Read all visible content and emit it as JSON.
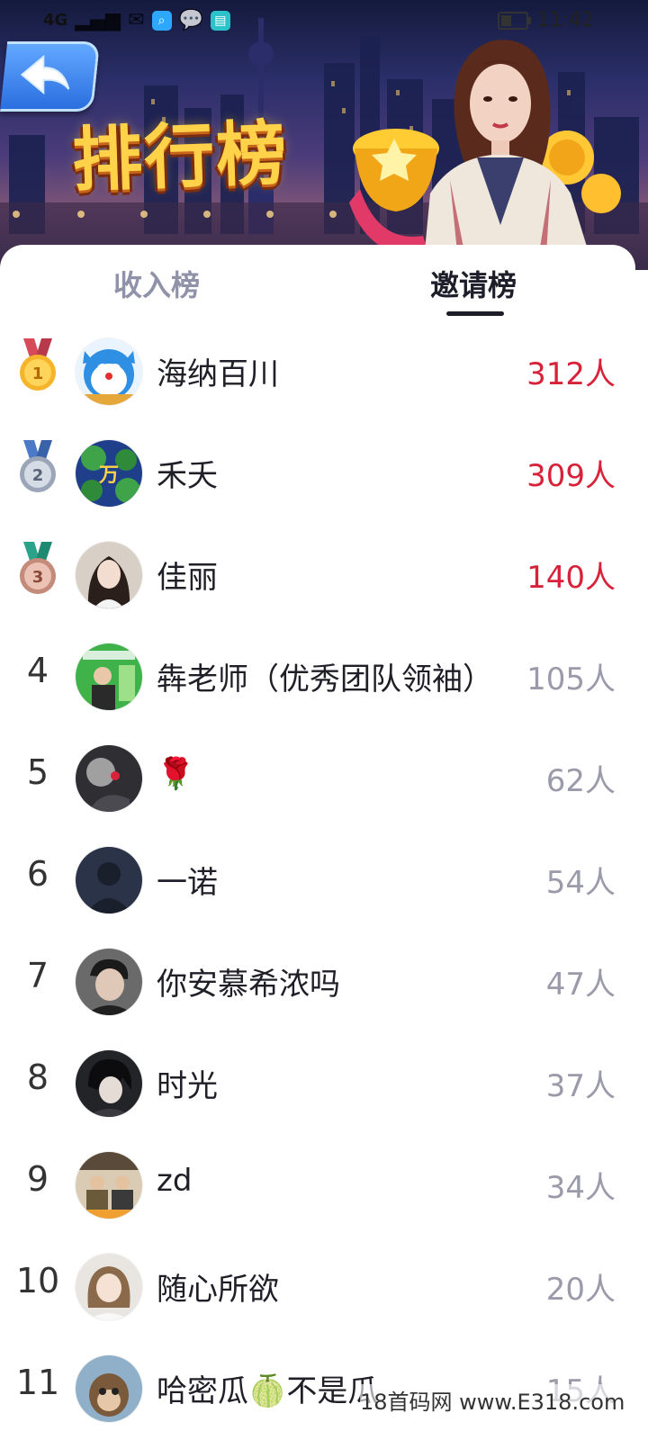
{
  "status_bar": {
    "signal_text": "4G",
    "time": "11:42",
    "battery_level": 0.45
  },
  "header": {
    "title": "排行榜"
  },
  "tabs": [
    {
      "label": "收入榜",
      "active": false
    },
    {
      "label": "邀请榜",
      "active": true
    }
  ],
  "colors": {
    "accent_red": "#d8223a",
    "count_gray": "#9a9aaa",
    "active_tab": "#1e1e2a",
    "inactive_tab": "#8f92a8"
  },
  "rows": [
    {
      "rank": "1",
      "medal": "gold-medal-icon",
      "name": "海纳百川",
      "count": "312人"
    },
    {
      "rank": "2",
      "medal": "silver-medal-icon",
      "name": "禾夭",
      "count": "309人"
    },
    {
      "rank": "3",
      "medal": "bronze-medal-icon",
      "name": "佳丽",
      "count": "140人"
    },
    {
      "rank": "4",
      "name": "犇老师（优秀团队领袖）",
      "count": "105人"
    },
    {
      "rank": "5",
      "name": "🌹",
      "count": "62人"
    },
    {
      "rank": "6",
      "name": "一诺",
      "count": "54人"
    },
    {
      "rank": "7",
      "name": "你安慕希浓吗",
      "count": "47人"
    },
    {
      "rank": "8",
      "name": "时光",
      "count": "37人"
    },
    {
      "rank": "9",
      "name": "zd",
      "count": "34人"
    },
    {
      "rank": "10",
      "name": "随心所欲",
      "count": "20人"
    },
    {
      "rank": "11",
      "name": "哈密瓜🍈不是瓜",
      "count": "15人"
    }
  ],
  "watermark": "18首码网 www.E318.com"
}
